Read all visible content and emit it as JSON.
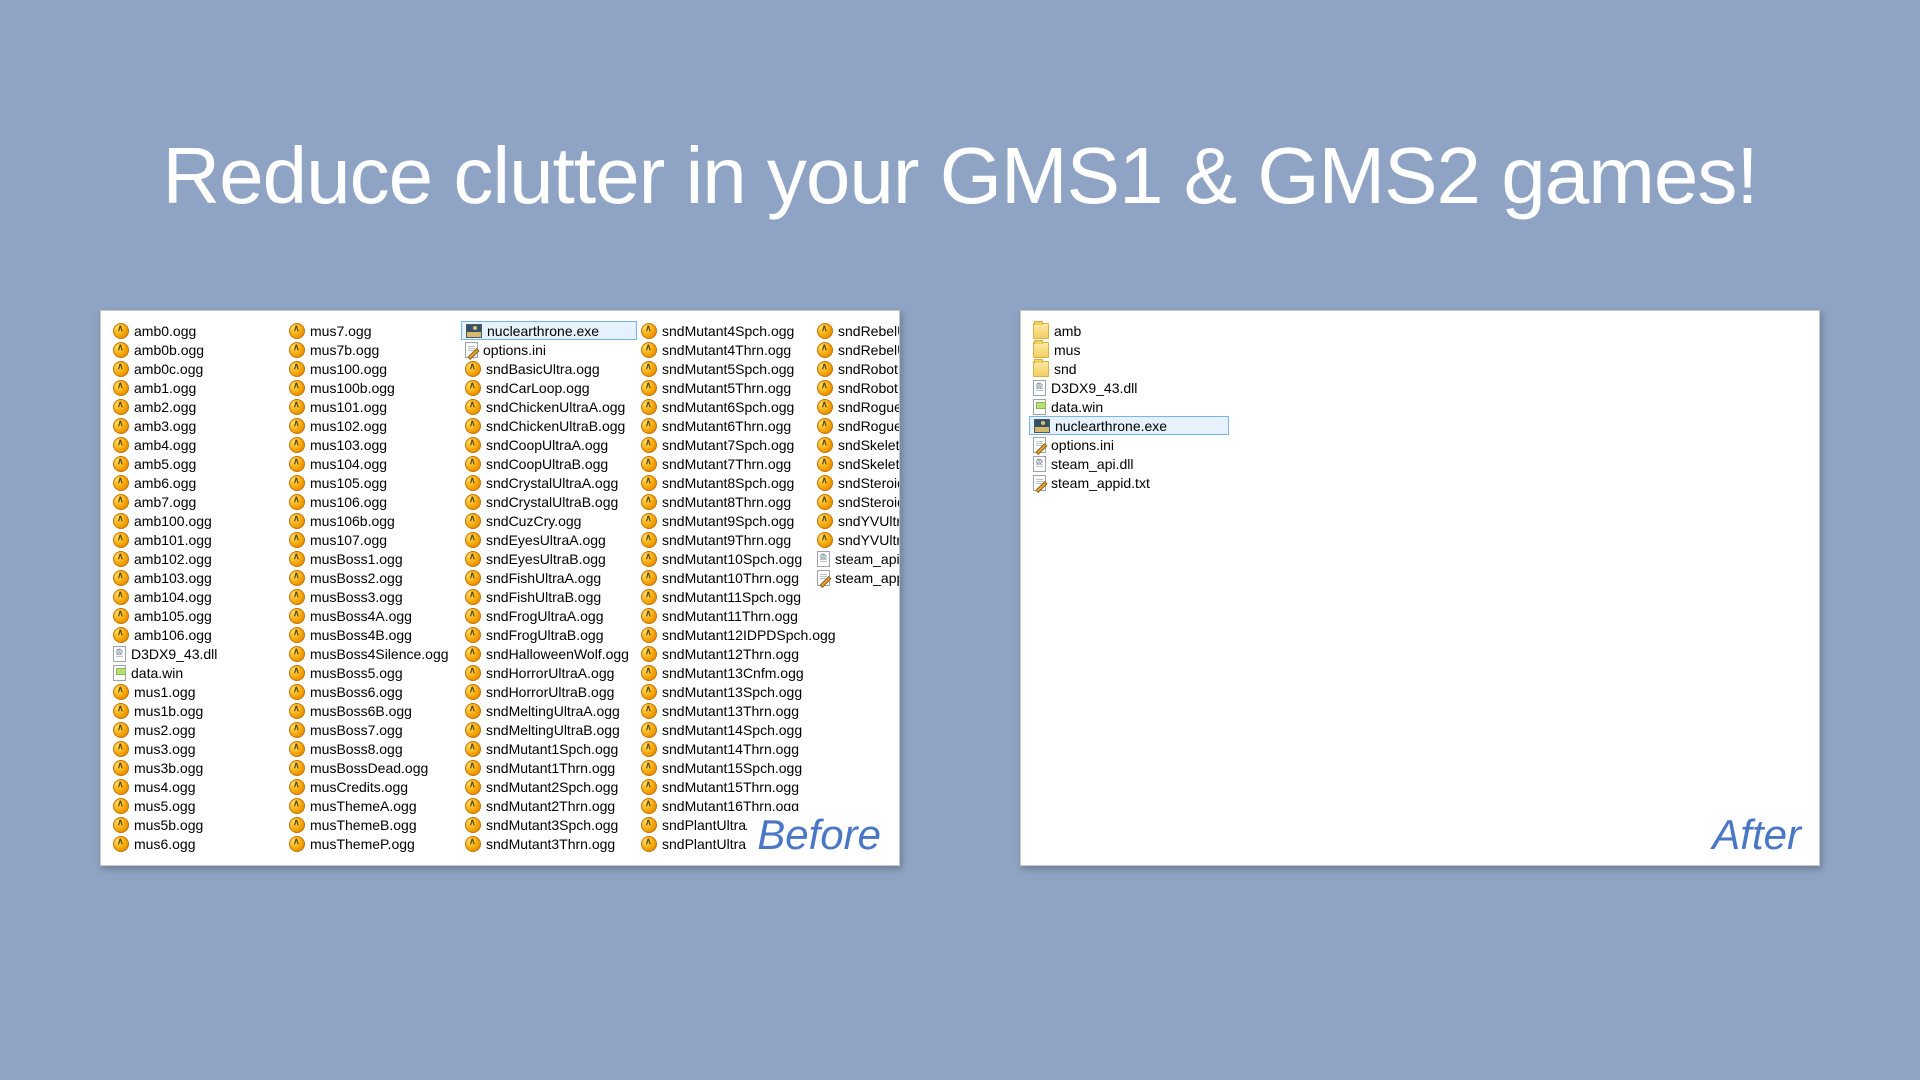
{
  "title": "Reduce clutter in your GMS1 & GMS2 games!",
  "captions": {
    "before": "Before",
    "after": "After"
  },
  "before": [
    {
      "n": "amb0.ogg",
      "t": "ogg"
    },
    {
      "n": "amb0b.ogg",
      "t": "ogg"
    },
    {
      "n": "amb0c.ogg",
      "t": "ogg"
    },
    {
      "n": "amb1.ogg",
      "t": "ogg"
    },
    {
      "n": "amb2.ogg",
      "t": "ogg"
    },
    {
      "n": "amb3.ogg",
      "t": "ogg"
    },
    {
      "n": "amb4.ogg",
      "t": "ogg"
    },
    {
      "n": "amb5.ogg",
      "t": "ogg"
    },
    {
      "n": "amb6.ogg",
      "t": "ogg"
    },
    {
      "n": "amb7.ogg",
      "t": "ogg"
    },
    {
      "n": "amb100.ogg",
      "t": "ogg"
    },
    {
      "n": "amb101.ogg",
      "t": "ogg"
    },
    {
      "n": "amb102.ogg",
      "t": "ogg"
    },
    {
      "n": "amb103.ogg",
      "t": "ogg"
    },
    {
      "n": "amb104.ogg",
      "t": "ogg"
    },
    {
      "n": "amb105.ogg",
      "t": "ogg"
    },
    {
      "n": "amb106.ogg",
      "t": "ogg"
    },
    {
      "n": "D3DX9_43.dll",
      "t": "dll"
    },
    {
      "n": "data.win",
      "t": "win"
    },
    {
      "n": "mus1.ogg",
      "t": "ogg"
    },
    {
      "n": "mus1b.ogg",
      "t": "ogg"
    },
    {
      "n": "mus2.ogg",
      "t": "ogg"
    },
    {
      "n": "mus3.ogg",
      "t": "ogg"
    },
    {
      "n": "mus3b.ogg",
      "t": "ogg"
    },
    {
      "n": "mus4.ogg",
      "t": "ogg"
    },
    {
      "n": "mus5.ogg",
      "t": "ogg"
    },
    {
      "n": "mus5b.ogg",
      "t": "ogg"
    },
    {
      "n": "mus6.ogg",
      "t": "ogg"
    },
    {
      "n": "mus7.ogg",
      "t": "ogg"
    },
    {
      "n": "mus7b.ogg",
      "t": "ogg"
    },
    {
      "n": "mus100.ogg",
      "t": "ogg"
    },
    {
      "n": "mus100b.ogg",
      "t": "ogg"
    },
    {
      "n": "mus101.ogg",
      "t": "ogg"
    },
    {
      "n": "mus102.ogg",
      "t": "ogg"
    },
    {
      "n": "mus103.ogg",
      "t": "ogg"
    },
    {
      "n": "mus104.ogg",
      "t": "ogg"
    },
    {
      "n": "mus105.ogg",
      "t": "ogg"
    },
    {
      "n": "mus106.ogg",
      "t": "ogg"
    },
    {
      "n": "mus106b.ogg",
      "t": "ogg"
    },
    {
      "n": "mus107.ogg",
      "t": "ogg"
    },
    {
      "n": "musBoss1.ogg",
      "t": "ogg"
    },
    {
      "n": "musBoss2.ogg",
      "t": "ogg"
    },
    {
      "n": "musBoss3.ogg",
      "t": "ogg"
    },
    {
      "n": "musBoss4A.ogg",
      "t": "ogg"
    },
    {
      "n": "musBoss4B.ogg",
      "t": "ogg"
    },
    {
      "n": "musBoss4Silence.ogg",
      "t": "ogg"
    },
    {
      "n": "musBoss5.ogg",
      "t": "ogg"
    },
    {
      "n": "musBoss6.ogg",
      "t": "ogg"
    },
    {
      "n": "musBoss6B.ogg",
      "t": "ogg"
    },
    {
      "n": "musBoss7.ogg",
      "t": "ogg"
    },
    {
      "n": "musBoss8.ogg",
      "t": "ogg"
    },
    {
      "n": "musBossDead.ogg",
      "t": "ogg"
    },
    {
      "n": "musCredits.ogg",
      "t": "ogg"
    },
    {
      "n": "musThemeA.ogg",
      "t": "ogg"
    },
    {
      "n": "musThemeB.ogg",
      "t": "ogg"
    },
    {
      "n": "musThemeP.ogg",
      "t": "ogg"
    },
    {
      "n": "nuclearthrone.exe",
      "t": "exe",
      "sel": true
    },
    {
      "n": "options.ini",
      "t": "ini"
    },
    {
      "n": "sndBasicUltra.ogg",
      "t": "ogg"
    },
    {
      "n": "sndCarLoop.ogg",
      "t": "ogg"
    },
    {
      "n": "sndChickenUltraA.ogg",
      "t": "ogg"
    },
    {
      "n": "sndChickenUltraB.ogg",
      "t": "ogg"
    },
    {
      "n": "sndCoopUltraA.ogg",
      "t": "ogg"
    },
    {
      "n": "sndCoopUltraB.ogg",
      "t": "ogg"
    },
    {
      "n": "sndCrystalUltraA.ogg",
      "t": "ogg"
    },
    {
      "n": "sndCrystalUltraB.ogg",
      "t": "ogg"
    },
    {
      "n": "sndCuzCry.ogg",
      "t": "ogg"
    },
    {
      "n": "sndEyesUltraA.ogg",
      "t": "ogg"
    },
    {
      "n": "sndEyesUltraB.ogg",
      "t": "ogg"
    },
    {
      "n": "sndFishUltraA.ogg",
      "t": "ogg"
    },
    {
      "n": "sndFishUltraB.ogg",
      "t": "ogg"
    },
    {
      "n": "sndFrogUltraA.ogg",
      "t": "ogg"
    },
    {
      "n": "sndFrogUltraB.ogg",
      "t": "ogg"
    },
    {
      "n": "sndHalloweenWolf.ogg",
      "t": "ogg"
    },
    {
      "n": "sndHorrorUltraA.ogg",
      "t": "ogg"
    },
    {
      "n": "sndHorrorUltraB.ogg",
      "t": "ogg"
    },
    {
      "n": "sndMeltingUltraA.ogg",
      "t": "ogg"
    },
    {
      "n": "sndMeltingUltraB.ogg",
      "t": "ogg"
    },
    {
      "n": "sndMutant1Spch.ogg",
      "t": "ogg"
    },
    {
      "n": "sndMutant1Thrn.ogg",
      "t": "ogg"
    },
    {
      "n": "sndMutant2Spch.ogg",
      "t": "ogg"
    },
    {
      "n": "sndMutant2Thrn.ogg",
      "t": "ogg"
    },
    {
      "n": "sndMutant3Spch.ogg",
      "t": "ogg"
    },
    {
      "n": "sndMutant3Thrn.ogg",
      "t": "ogg"
    },
    {
      "n": "sndMutant4Spch.ogg",
      "t": "ogg"
    },
    {
      "n": "sndMutant4Thrn.ogg",
      "t": "ogg"
    },
    {
      "n": "sndMutant5Spch.ogg",
      "t": "ogg"
    },
    {
      "n": "sndMutant5Thrn.ogg",
      "t": "ogg"
    },
    {
      "n": "sndMutant6Spch.ogg",
      "t": "ogg"
    },
    {
      "n": "sndMutant6Thrn.ogg",
      "t": "ogg"
    },
    {
      "n": "sndMutant7Spch.ogg",
      "t": "ogg"
    },
    {
      "n": "sndMutant7Thrn.ogg",
      "t": "ogg"
    },
    {
      "n": "sndMutant8Spch.ogg",
      "t": "ogg"
    },
    {
      "n": "sndMutant8Thrn.ogg",
      "t": "ogg"
    },
    {
      "n": "sndMutant9Spch.ogg",
      "t": "ogg"
    },
    {
      "n": "sndMutant9Thrn.ogg",
      "t": "ogg"
    },
    {
      "n": "sndMutant10Spch.ogg",
      "t": "ogg"
    },
    {
      "n": "sndMutant10Thrn.ogg",
      "t": "ogg"
    },
    {
      "n": "sndMutant11Spch.ogg",
      "t": "ogg"
    },
    {
      "n": "sndMutant11Thrn.ogg",
      "t": "ogg"
    },
    {
      "n": "sndMutant12IDPDSpch.ogg",
      "t": "ogg"
    },
    {
      "n": "sndMutant12Thrn.ogg",
      "t": "ogg"
    },
    {
      "n": "sndMutant13Cnfm.ogg",
      "t": "ogg"
    },
    {
      "n": "sndMutant13Spch.ogg",
      "t": "ogg"
    },
    {
      "n": "sndMutant13Thrn.ogg",
      "t": "ogg"
    },
    {
      "n": "sndMutant14Spch.ogg",
      "t": "ogg"
    },
    {
      "n": "sndMutant14Thrn.ogg",
      "t": "ogg"
    },
    {
      "n": "sndMutant15Spch.ogg",
      "t": "ogg"
    },
    {
      "n": "sndMutant15Thrn.ogg",
      "t": "ogg"
    },
    {
      "n": "sndMutant16Thrn.ogg",
      "t": "ogg"
    },
    {
      "n": "sndPlantUltraA.ogg",
      "t": "ogg"
    },
    {
      "n": "sndPlantUltraB.ogg",
      "t": "ogg"
    },
    {
      "n": "sndRebelUltraA.ogg",
      "t": "ogg"
    },
    {
      "n": "sndRebelUltraB.ogg",
      "t": "ogg"
    },
    {
      "n": "sndRobotUltraA.ogg",
      "t": "ogg"
    },
    {
      "n": "sndRobotUltraB.ogg",
      "t": "ogg"
    },
    {
      "n": "sndRogueUltraA.ogg",
      "t": "ogg"
    },
    {
      "n": "sndRogueUltraB.ogg",
      "t": "ogg"
    },
    {
      "n": "sndSkeletonUltraA.ogg",
      "t": "ogg"
    },
    {
      "n": "sndSkeletonUltraB.ogg",
      "t": "ogg"
    },
    {
      "n": "sndSteroidsUltraA.ogg",
      "t": "ogg"
    },
    {
      "n": "sndSteroidsUltraB.ogg",
      "t": "ogg"
    },
    {
      "n": "sndYVUltraA.ogg",
      "t": "ogg"
    },
    {
      "n": "sndYVUltraB.ogg",
      "t": "ogg"
    },
    {
      "n": "steam_api.dll",
      "t": "dll"
    },
    {
      "n": "steam_appid.txt",
      "t": "ini"
    }
  ],
  "after": [
    {
      "n": "amb",
      "t": "folder"
    },
    {
      "n": "mus",
      "t": "folder"
    },
    {
      "n": "snd",
      "t": "folder"
    },
    {
      "n": "D3DX9_43.dll",
      "t": "dll"
    },
    {
      "n": "data.win",
      "t": "win"
    },
    {
      "n": "nuclearthrone.exe",
      "t": "exe",
      "sel": true
    },
    {
      "n": "options.ini",
      "t": "ini"
    },
    {
      "n": "steam_api.dll",
      "t": "dll"
    },
    {
      "n": "steam_appid.txt",
      "t": "ini"
    }
  ]
}
